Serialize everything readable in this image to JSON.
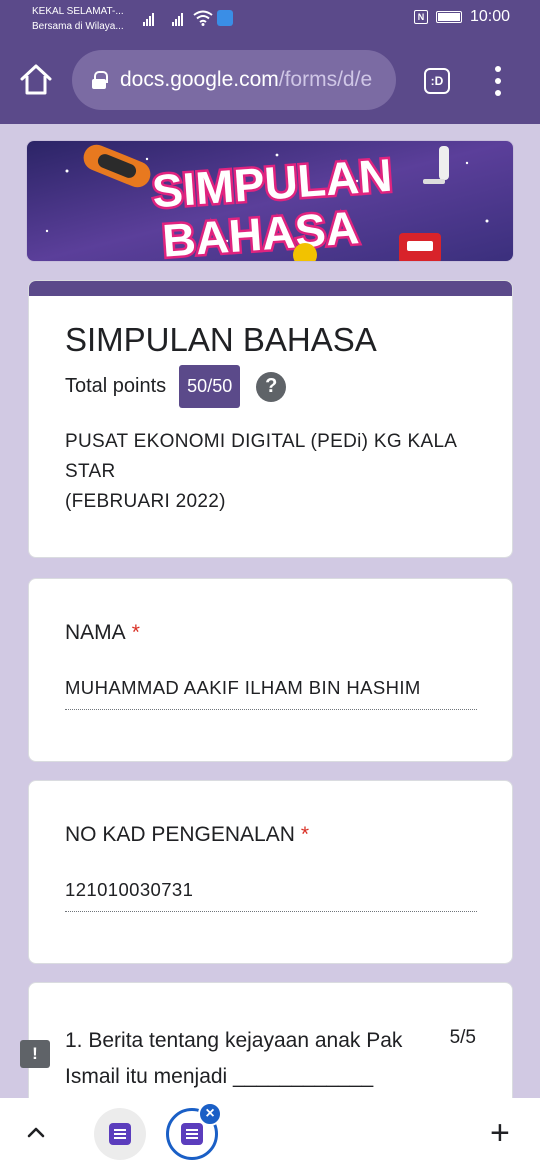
{
  "status_bar": {
    "carrier_line1": "KEKAL SELAMAT-...",
    "carrier_line2": "Bersama di Wilaya...",
    "time": "10:00",
    "icons": [
      "signal-icon",
      "signal-icon",
      "wifi-icon",
      "app-notification-icon",
      "nfc-icon",
      "battery-icon"
    ]
  },
  "browser": {
    "url_host": "docs.google.com",
    "url_path": "/forms/d/e",
    "reader_label": ":D",
    "icons": [
      "home-icon",
      "lock-icon",
      "reader-mode-icon",
      "more-vert-icon"
    ]
  },
  "banner": {
    "line1": "SIMPULAN",
    "line2": "BAHASA"
  },
  "form": {
    "title": "SIMPULAN BAHASA",
    "points_label": "Total points",
    "score": "50/50",
    "help_glyph": "?",
    "description_line1": "PUSAT EKONOMI DIGITAL (PEDi) KG KALA STAR",
    "description_line2": "(FEBRUARI 2022)",
    "accent_color": "#5b4a8a"
  },
  "questions": [
    {
      "label": "NAMA",
      "required_mark": "*",
      "answer": "MUHAMMAD AAKIF ILHAM BIN HASHIM"
    },
    {
      "label": "NO KAD PENGENALAN",
      "required_mark": "*",
      "answer": "121010030731"
    },
    {
      "text": "1. Berita tentang kejayaan anak Pak Ismail itu menjadi ____________",
      "score": "5/5"
    }
  ],
  "feedback_glyph": "!",
  "tab_bar": {
    "close_glyph": "×",
    "new_tab_glyph": "+",
    "icons": [
      "chevron-up-icon",
      "forms-icon",
      "forms-icon",
      "close-icon",
      "plus-icon"
    ]
  }
}
